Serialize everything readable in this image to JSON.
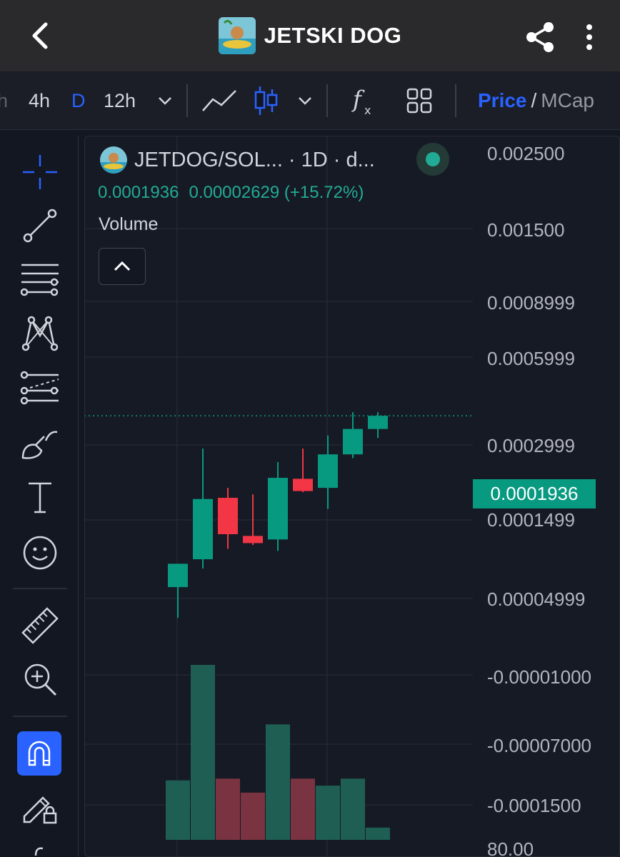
{
  "header": {
    "title": "JETSKI DOG"
  },
  "toolbar": {
    "intervals": [
      {
        "label": "h",
        "active": false
      },
      {
        "label": "4h",
        "active": false
      },
      {
        "label": "D",
        "active": true
      },
      {
        "label": "12h",
        "active": false
      }
    ],
    "price_label": "Price",
    "separator": "/",
    "mcap_label": "MCap"
  },
  "legend": {
    "symbol": "JETDOG/SOL... · 1D · d...",
    "close": "0.0001936",
    "change": "0.00002629 (+15.72%)",
    "volume_label": "Volume"
  },
  "price_axis": [
    "0.002500",
    "0.001500",
    "0.0008999",
    "0.0005999",
    "0.0002999",
    "0.0001499",
    "0.00004999",
    "-0.00001000",
    "-0.00007000",
    "-0.0001500",
    "80.00"
  ],
  "last_price_tag": "0.0001936",
  "colors": {
    "up": "#089981",
    "down": "#f23645",
    "accent": "#2962ff",
    "background": "#131722"
  },
  "chart_data": {
    "type": "candlestick",
    "scale": "log",
    "title": "JETDOG/SOL · 1D",
    "ylim": [
      2e-05,
      0.0028
    ],
    "candles": [
      {
        "open": 3.3e-05,
        "high": 4.1e-05,
        "low": 2.4e-05,
        "close": 4.2e-05
      },
      {
        "open": 4.4e-05,
        "high": 0.000138,
        "low": 4e-05,
        "close": 8.2e-05
      },
      {
        "open": 8.3e-05,
        "high": 9.2e-05,
        "low": 4.9e-05,
        "close": 5.7e-05
      },
      {
        "open": 5.6e-05,
        "high": 8.6e-05,
        "low": 5.1e-05,
        "close": 5.2e-05
      },
      {
        "open": 5.4e-05,
        "high": 0.00012,
        "low": 4.8e-05,
        "close": 0.000102
      },
      {
        "open": 0.000101,
        "high": 0.000138,
        "low": 8.8e-05,
        "close": 8.9e-05
      },
      {
        "open": 9.2e-05,
        "high": 0.000158,
        "low": 7.4e-05,
        "close": 0.00013
      },
      {
        "open": 0.00013,
        "high": 0.000201,
        "low": 0.000125,
        "close": 0.000169
      },
      {
        "open": 0.000169,
        "high": 0.000201,
        "low": 0.000154,
        "close": 0.0001936
      }
    ],
    "volume": {
      "unit": "relative",
      "values": [
        0.34,
        1.0,
        0.35,
        0.27,
        0.66,
        0.35,
        0.31,
        0.35,
        0.07
      ],
      "direction": [
        "up",
        "up",
        "down",
        "down",
        "up",
        "down",
        "up",
        "up",
        "up"
      ]
    },
    "last_price": 0.0001936
  }
}
